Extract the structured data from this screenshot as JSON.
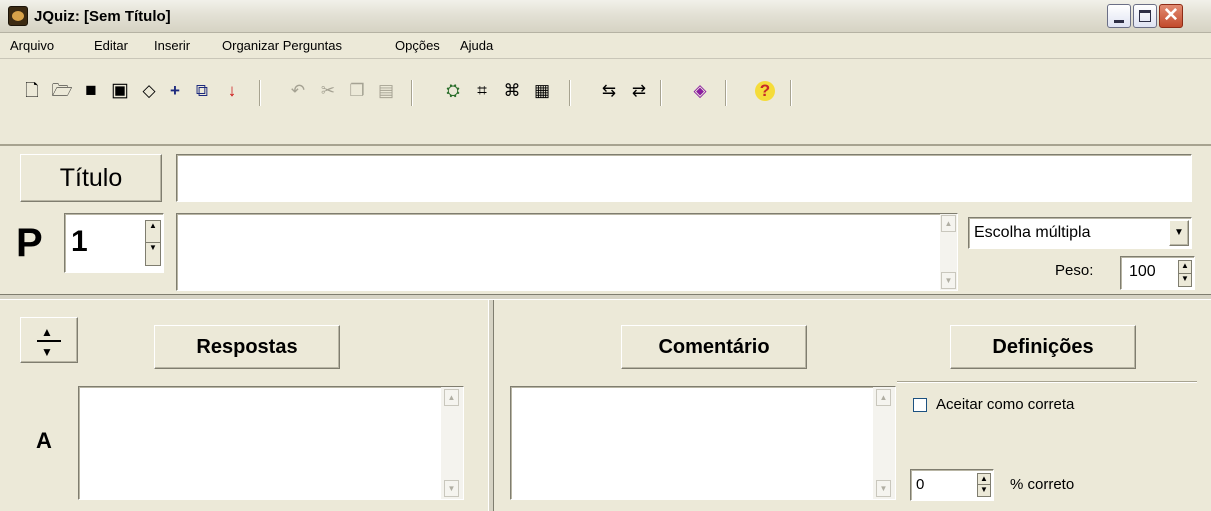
{
  "window": {
    "title": "JQuiz: [Sem Título]"
  },
  "menu": [
    "Arquivo",
    "Editar",
    "Inserir",
    "Organizar Perguntas",
    "Opções",
    "Ajuda"
  ],
  "toolbar": {
    "new": "new-file-icon",
    "open": "open-folder-icon",
    "save": "save-icon",
    "save_as": "save-as-icon",
    "eraser": "eraser-icon",
    "add": "plus-icon",
    "web": "web-export-icon",
    "arrow_down": "red-down-arrow-icon",
    "undo": "undo-icon",
    "cut": "cut-icon",
    "copy": "copy-icon",
    "paste": "paste-icon",
    "config": "config-icon",
    "export1": "export-page-icon",
    "export2": "export-page-2-icon",
    "grid": "grid-icon",
    "swap1": "swap-left-icon",
    "swap2": "swap-right-icon",
    "hotpot": "hotpot-icon",
    "help": "help-icon"
  },
  "title_label": "Título",
  "title_value": "",
  "question": {
    "letter": "P",
    "number": "1",
    "text": "",
    "type": "Escolha múltipla",
    "peso_label": "Peso:",
    "peso_value": "100"
  },
  "answers": {
    "respostas_label": "Respostas",
    "comentario_label": "Comentário",
    "definicoes_label": "Definições",
    "letter": "A",
    "answer_text": "",
    "comment_text": "",
    "accept_label": "Aceitar como correta",
    "accept_checked": false,
    "percent_value": "0",
    "percent_label": "% correto"
  }
}
